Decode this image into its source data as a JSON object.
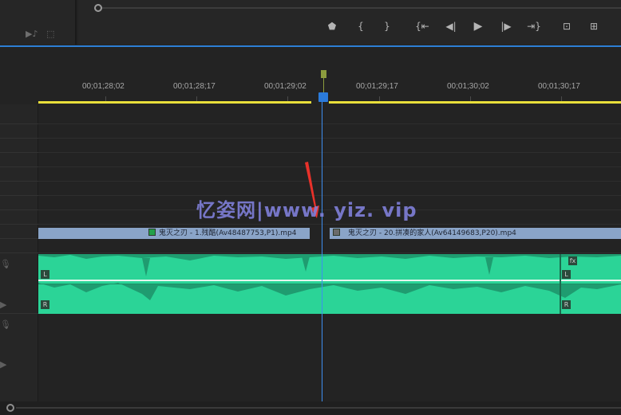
{
  "monitor": {
    "transport": {
      "marker": "⬟",
      "mark_in": "{",
      "mark_out": "}",
      "go_to_in": "{⇤",
      "step_back": "◀|",
      "play": "▶",
      "step_forward": "|▶",
      "go_to_out": "⇥}",
      "lift": "⊡",
      "extract": "⊞"
    }
  },
  "ruler": {
    "timecodes": [
      "00;01;28;02",
      "00;01;28;17",
      "00;01;29;02",
      "00;01;29;17",
      "00;01;30;02",
      "00;01;30;17"
    ]
  },
  "clips": {
    "video": [
      {
        "label": "鬼灭之刃 - 1.残酷(Av48487753,P1).mp4"
      },
      {
        "label": "鬼灭之刃 - 20.拼凑的家人(Av64149683,P20).mp4"
      }
    ],
    "audio": {
      "left_channel": "L",
      "right_channel": "R"
    }
  },
  "watermark": "忆姿网|www. yiz. vip",
  "colors": {
    "audio": "#2bd497",
    "video_clip": "#8aa4c8",
    "playhead": "#2b7bdb",
    "work_area": "#e9df3a",
    "annotation_arrow": "#e8312a"
  }
}
